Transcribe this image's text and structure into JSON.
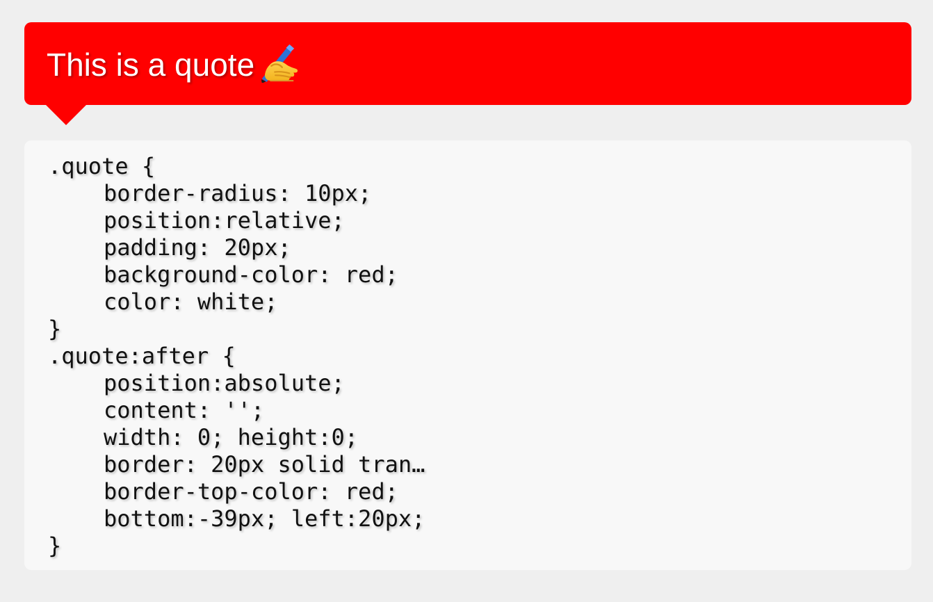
{
  "quote": {
    "text": "This is a quote",
    "icon": "writing-hand-icon",
    "background_color": "#ff0000",
    "text_color": "#ffffff"
  },
  "code": {
    "lines": [
      ".quote {",
      "border-radius: 10px;",
      "position:relative;",
      "padding: 20px;",
      "background-color: red;",
      "color: white;",
      "}",
      ".quote:after {",
      "position:absolute;",
      "content: '';",
      "width: 0; height:0;",
      "border: 20px solid tran…",
      "border-top-color: red;",
      "bottom:-39px; left:20px;",
      "}"
    ]
  }
}
